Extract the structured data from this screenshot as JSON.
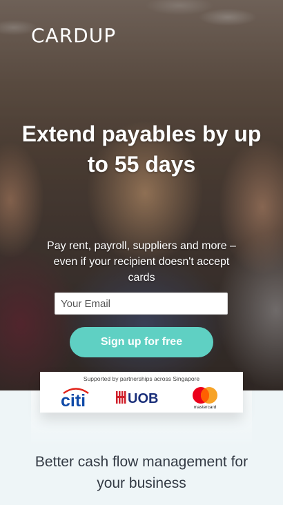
{
  "brand": {
    "logo_text": "CARDUP"
  },
  "hero": {
    "headline": "Extend payables by up to 55 days",
    "subtext": "Pay rent, payroll, suppliers and more – even if your recipient doesn't accept cards",
    "email_placeholder": "Your Email",
    "signup_label": "Sign up for free",
    "accent_color": "#5fd0c3"
  },
  "partners": {
    "caption": "Supported by partnerships across Singapore",
    "logos": [
      {
        "name": "citi",
        "icon": "citi-logo"
      },
      {
        "name": "UOB",
        "icon": "uob-logo",
        "text": "UOB"
      },
      {
        "name": "mastercard",
        "icon": "mastercard-logo",
        "text": "mastercard"
      }
    ]
  },
  "tagline": "Better cash flow management for your business"
}
